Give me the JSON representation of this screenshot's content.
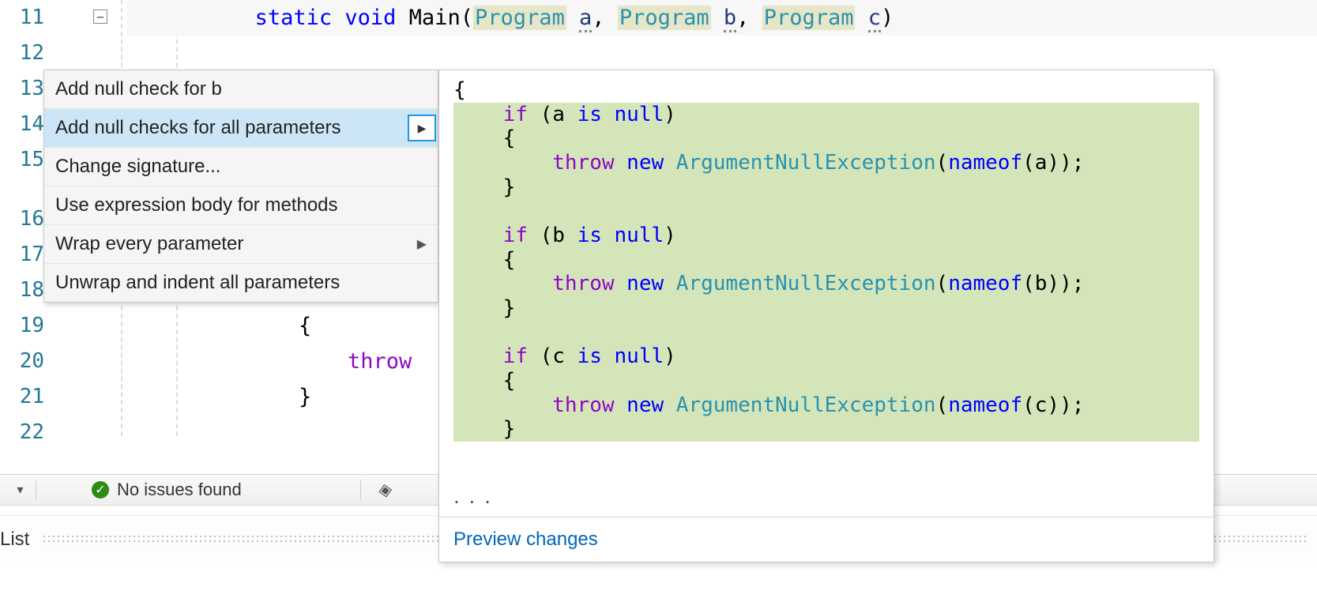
{
  "editor": {
    "line_numbers": [
      "11",
      "12",
      "13",
      "14",
      "15",
      "16",
      "17",
      "18",
      "19",
      "20",
      "21",
      "22"
    ],
    "outline_toggle": "−",
    "signature": {
      "kw_static": "static",
      "kw_void": "void",
      "method": "Main",
      "type": "Program",
      "param_a": "a",
      "param_b": "b",
      "param_c": "c",
      "comma": ",",
      "open": "(",
      "close": ")"
    },
    "bg_line19": "{",
    "bg_line20": "throw",
    "bg_line21": "}"
  },
  "quick_actions": {
    "items": [
      {
        "label": "Add null check for b",
        "has_sub": false
      },
      {
        "label": "Add null checks for all parameters",
        "has_sub": true,
        "selected": true
      },
      {
        "label": "Change signature...",
        "has_sub": false
      },
      {
        "label": "Use expression body for methods",
        "has_sub": false
      },
      {
        "label": "Wrap every parameter",
        "has_sub": true
      },
      {
        "label": "Unwrap and indent all parameters",
        "has_sub": false
      }
    ],
    "flyout_glyph": "▶"
  },
  "preview": {
    "open_brace": "{",
    "blocks": [
      {
        "if_kw": "if",
        "open": "(",
        "var": "a",
        "is_kw": "is",
        "null_kw": "null",
        "close": ")",
        "brace_open": "{",
        "throw_kw": "throw",
        "new_kw": "new",
        "exc_type": "ArgumentNullException",
        "p_open": "(",
        "nameof_kw": "nameof",
        "n_open": "(",
        "n_arg": "a",
        "n_close": ")",
        "p_close": ")",
        "semi": ";",
        "brace_close": "}"
      },
      {
        "if_kw": "if",
        "open": "(",
        "var": "b",
        "is_kw": "is",
        "null_kw": "null",
        "close": ")",
        "brace_open": "{",
        "throw_kw": "throw",
        "new_kw": "new",
        "exc_type": "ArgumentNullException",
        "p_open": "(",
        "nameof_kw": "nameof",
        "n_open": "(",
        "n_arg": "b",
        "n_close": ")",
        "p_close": ")",
        "semi": ";",
        "brace_close": "}"
      },
      {
        "if_kw": "if",
        "open": "(",
        "var": "c",
        "is_kw": "is",
        "null_kw": "null",
        "close": ")",
        "brace_open": "{",
        "throw_kw": "throw",
        "new_kw": "new",
        "exc_type": "ArgumentNullException",
        "p_open": "(",
        "nameof_kw": "nameof",
        "n_open": "(",
        "n_arg": "c",
        "n_close": ")",
        "p_close": ")",
        "semi": ";",
        "brace_close": "}"
      }
    ],
    "ellipsis": ". . .",
    "footer_link": "Preview changes"
  },
  "status": {
    "dropdown_glyph": "▾",
    "ok_glyph": "✓",
    "text": "No issues found",
    "paint_glyph": "◈"
  },
  "bottom": {
    "tab_label": "List"
  }
}
